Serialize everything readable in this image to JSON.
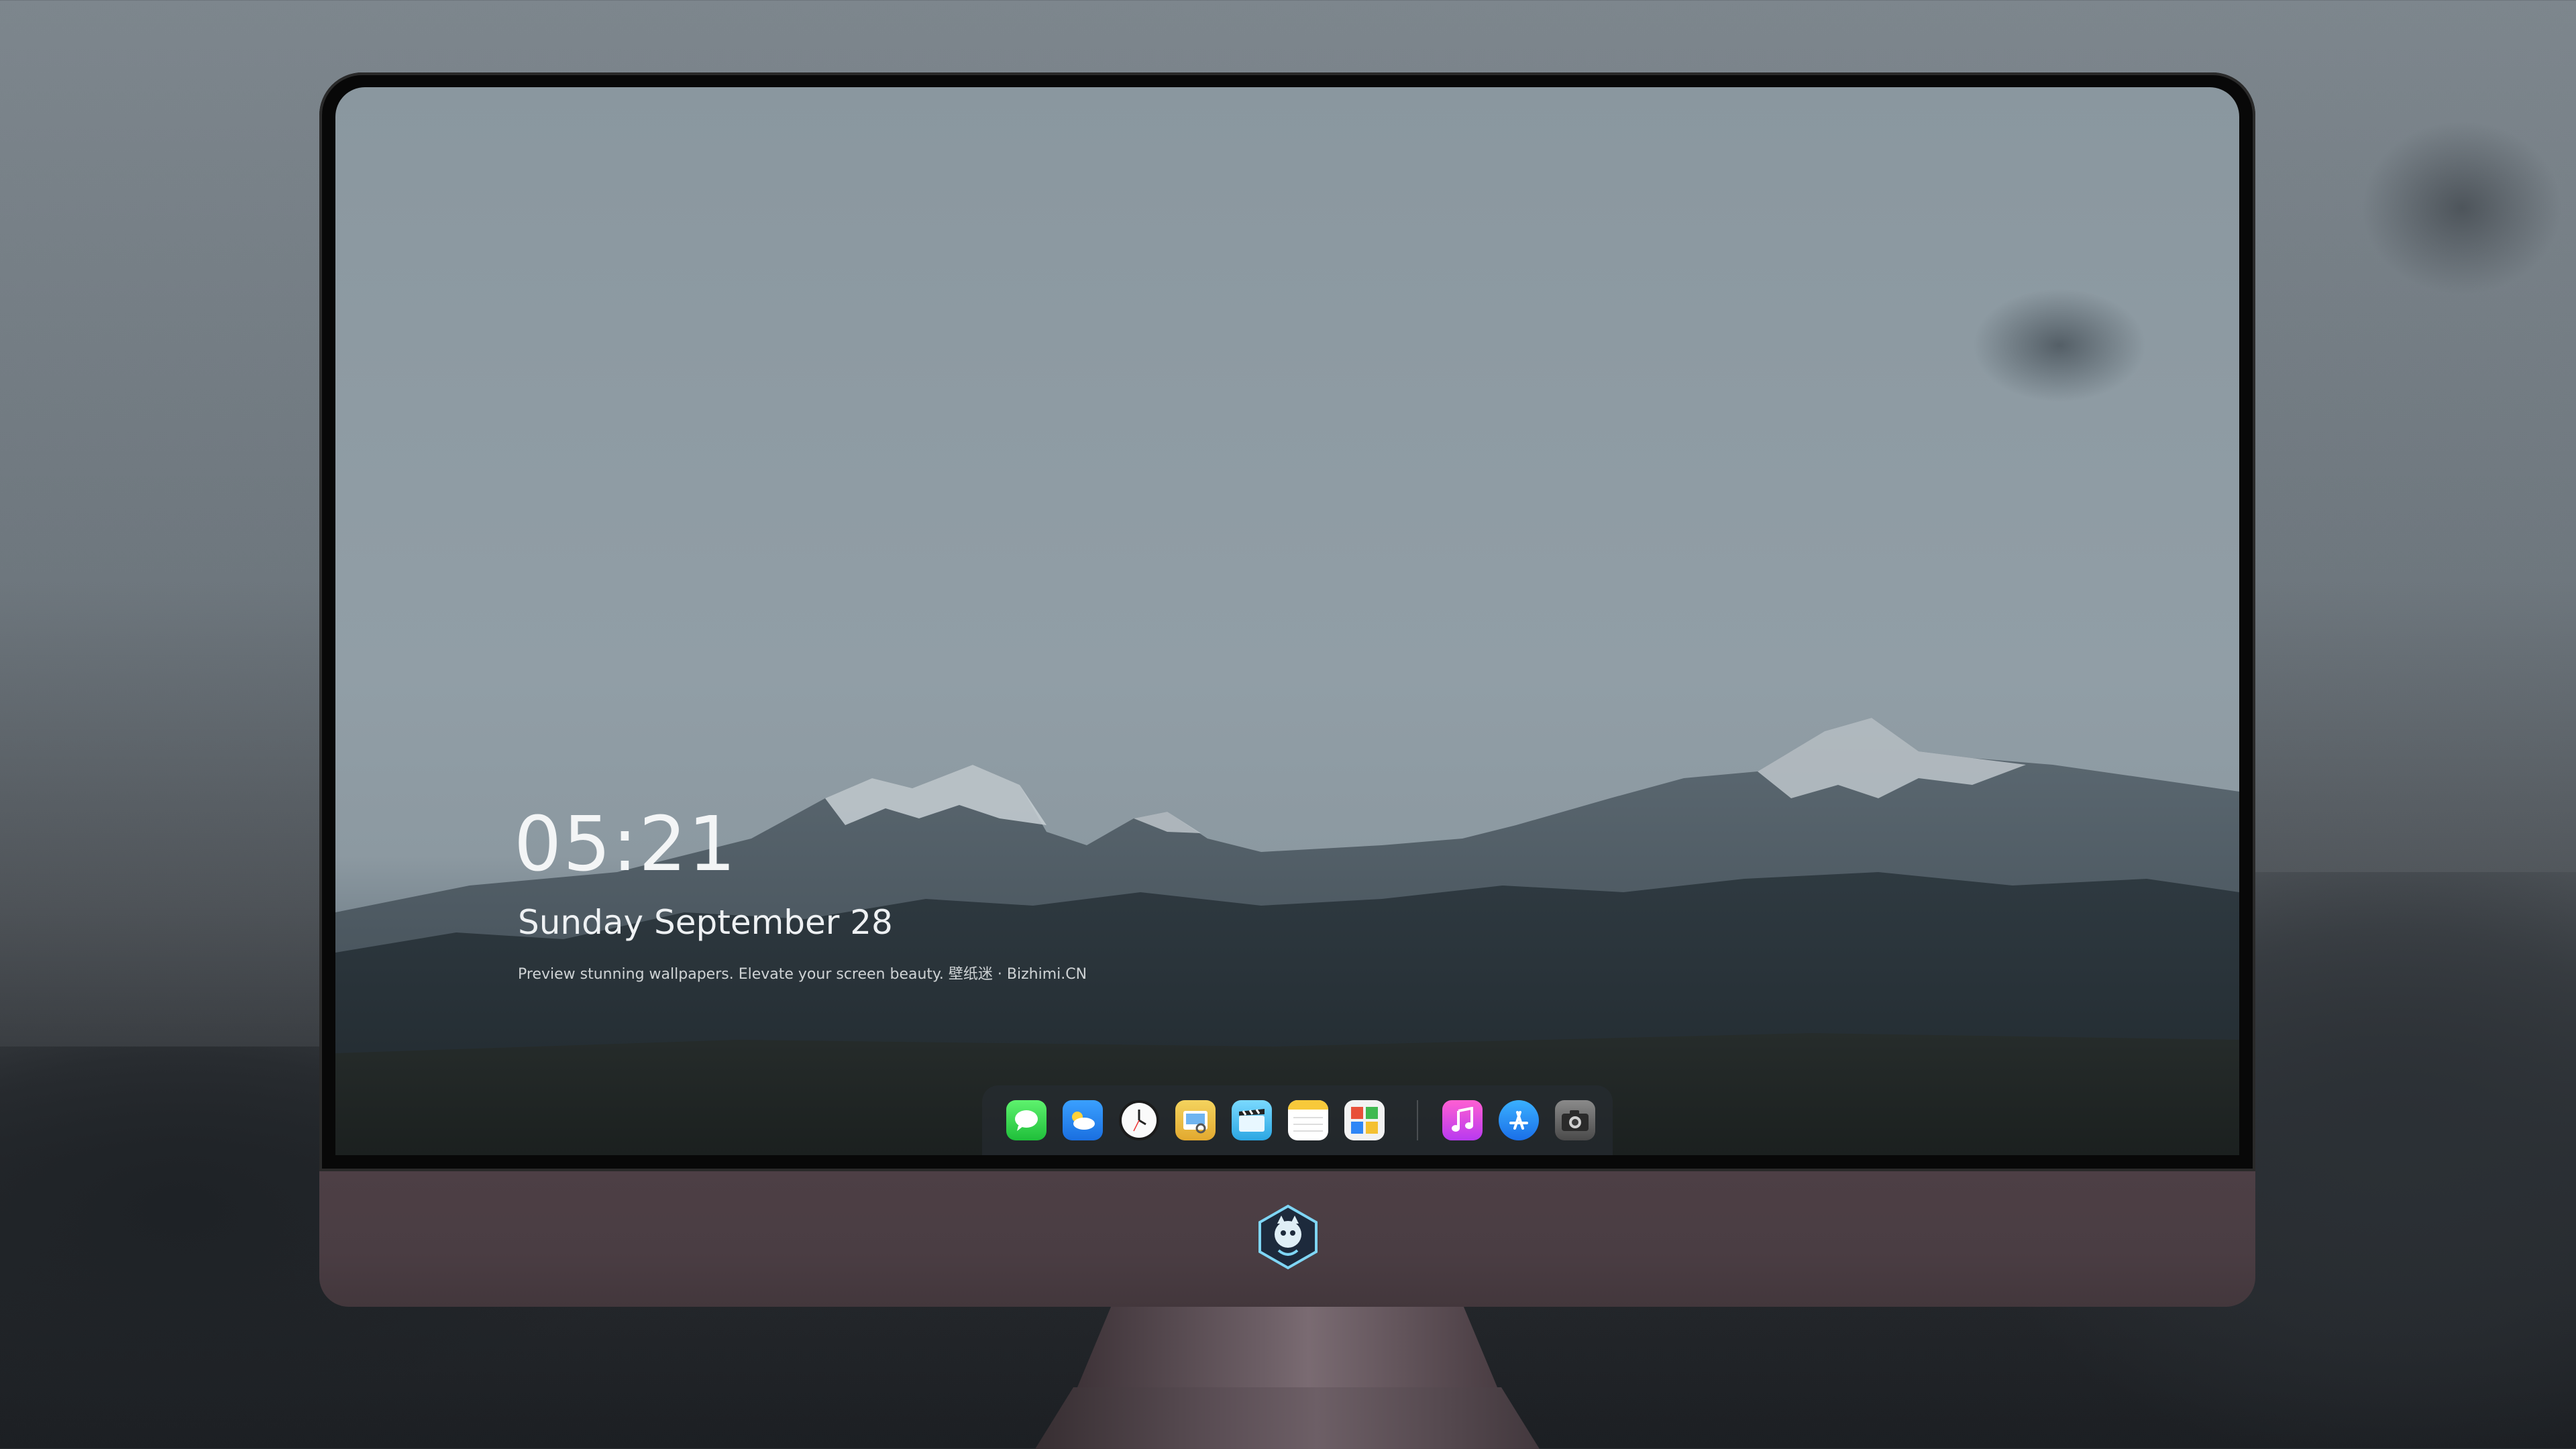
{
  "lockscreen": {
    "time": "05:21",
    "date": "Sunday September  28",
    "tagline": "Preview stunning wallpapers. Elevate your screen beauty. 壁纸迷 · Bizhimi.CN"
  },
  "dock": {
    "apps": [
      {
        "icon": "messages-icon",
        "color": "#28c840"
      },
      {
        "icon": "weather-icon",
        "color": "#2e8ff2"
      },
      {
        "icon": "clock-icon",
        "color": "#f5f5f5"
      },
      {
        "icon": "preview-icon",
        "color": "#e9c34a"
      },
      {
        "icon": "clips-icon",
        "color": "#38b6e8"
      },
      {
        "icon": "notes-icon",
        "color": "#f7d04a"
      },
      {
        "icon": "photo-booth-icon",
        "color": "#e65a3c"
      },
      {
        "icon": "music-icon",
        "color": "#e34ac8"
      },
      {
        "icon": "app-store-icon",
        "color": "#2a86f5"
      },
      {
        "icon": "camera-icon",
        "color": "#6a6a6a"
      }
    ]
  },
  "colors": {
    "monitor_bezel": "#080808",
    "monitor_chin": "#4a3d43"
  }
}
